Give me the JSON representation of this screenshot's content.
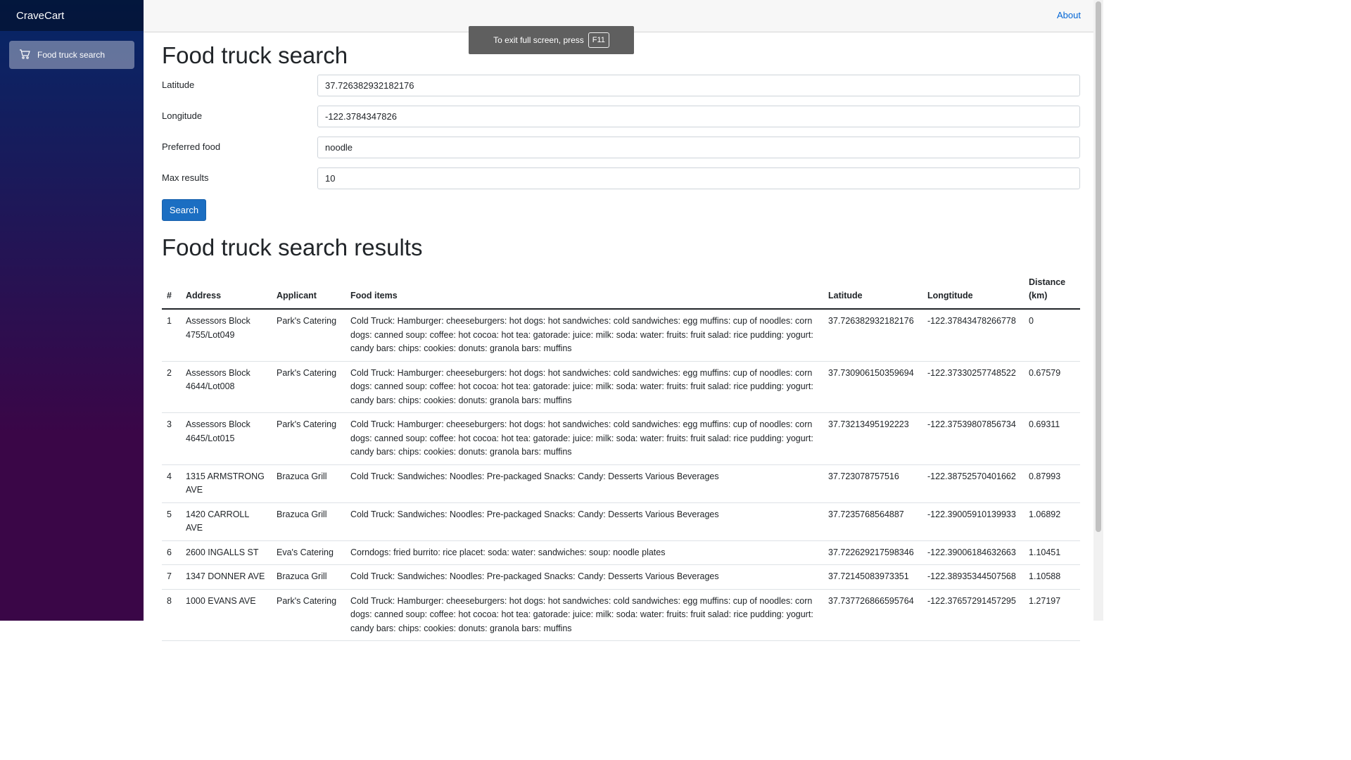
{
  "app": {
    "brand": "CraveCart"
  },
  "sidebar": {
    "items": [
      {
        "label": "Food truck search",
        "icon": "cart-icon"
      }
    ]
  },
  "topbar": {
    "about_label": "About"
  },
  "fullscreen_toast": {
    "text": "To exit full screen, press",
    "key": "F11"
  },
  "page": {
    "title": "Food truck search",
    "results_title": "Food truck search results"
  },
  "form": {
    "latitude": {
      "label": "Latitude",
      "value": "37.726382932182176"
    },
    "longitude": {
      "label": "Longitude",
      "value": "-122.3784347826"
    },
    "preferred_food": {
      "label": "Preferred food",
      "value": "noodle"
    },
    "max_results": {
      "label": "Max results",
      "value": "10"
    },
    "search_label": "Search"
  },
  "table": {
    "headers": [
      "#",
      "Address",
      "Applicant",
      "Food items",
      "Latitude",
      "Longtitude",
      "Distance (km)"
    ],
    "rows": [
      [
        "1",
        "Assessors Block 4755/Lot049",
        "Park's Catering",
        "Cold Truck: Hamburger: cheeseburgers: hot dogs: hot sandwiches: cold sandwiches: egg muffins: cup of noodles: corn dogs: canned soup: coffee: hot cocoa: hot tea: gatorade: juice: milk: soda: water: fruits: fruit salad: rice pudding: yogurt: candy bars: chips: cookies: donuts: granola bars: muffins",
        "37.726382932182176",
        "-122.37843478266778",
        "0"
      ],
      [
        "2",
        "Assessors Block 4644/Lot008",
        "Park's Catering",
        "Cold Truck: Hamburger: cheeseburgers: hot dogs: hot sandwiches: cold sandwiches: egg muffins: cup of noodles: corn dogs: canned soup: coffee: hot cocoa: hot tea: gatorade: juice: milk: soda: water: fruits: fruit salad: rice pudding: yogurt: candy bars: chips: cookies: donuts: granola bars: muffins",
        "37.730906150359694",
        "-122.37330257748522",
        "0.67579"
      ],
      [
        "3",
        "Assessors Block 4645/Lot015",
        "Park's Catering",
        "Cold Truck: Hamburger: cheeseburgers: hot dogs: hot sandwiches: cold sandwiches: egg muffins: cup of noodles: corn dogs: canned soup: coffee: hot cocoa: hot tea: gatorade: juice: milk: soda: water: fruits: fruit salad: rice pudding: yogurt: candy bars: chips: cookies: donuts: granola bars: muffins",
        "37.73213495192223",
        "-122.37539807856734",
        "0.69311"
      ],
      [
        "4",
        "1315 ARMSTRONG AVE",
        "Brazuca Grill",
        "Cold Truck: Sandwiches: Noodles: Pre-packaged Snacks: Candy: Desserts Various Beverages",
        "37.723078757516",
        "-122.38752570401662",
        "0.87993"
      ],
      [
        "5",
        "1420 CARROLL AVE",
        "Brazuca Grill",
        "Cold Truck: Sandwiches: Noodles: Pre-packaged Snacks: Candy: Desserts Various Beverages",
        "37.7235768564887",
        "-122.39005910139933",
        "1.06892"
      ],
      [
        "6",
        "2600 INGALLS ST",
        "Eva's Catering",
        "Corndogs: fried burrito: rice placet: soda: water: sandwiches: soup: noodle plates",
        "37.722629217598346",
        "-122.39006184632663",
        "1.10451"
      ],
      [
        "7",
        "1347 DONNER AVE",
        "Brazuca Grill",
        "Cold Truck: Sandwiches: Noodles: Pre-packaged Snacks: Candy: Desserts Various Beverages",
        "37.72145083973351",
        "-122.38935344507568",
        "1.10588"
      ],
      [
        "8",
        "1000 EVANS AVE",
        "Park's Catering",
        "Cold Truck: Hamburger: cheeseburgers: hot dogs: hot sandwiches: cold sandwiches: egg muffins: cup of noodles: corn dogs: canned soup: coffee: hot cocoa: hot tea: gatorade: juice: milk: soda: water: fruits: fruit salad: rice pudding: yogurt: candy bars: chips: cookies: donuts: granola bars: muffins",
        "37.737726866595764",
        "-122.37657291457295",
        "1.27197"
      ]
    ]
  }
}
